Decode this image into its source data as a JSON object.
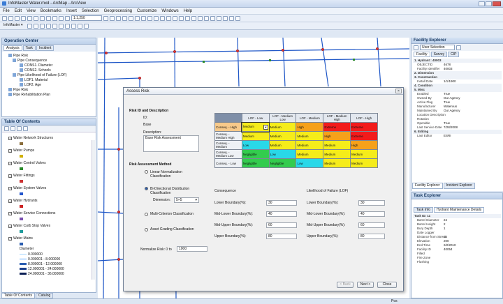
{
  "window": {
    "title": "InfoMaster Water.mxd - ArcMap - ArcView"
  },
  "menu": [
    "File",
    "Edit",
    "View",
    "Bookmarks",
    "Insert",
    "Selection",
    "Geoprocessing",
    "Customize",
    "Windows",
    "Help"
  ],
  "toolbar": {
    "scale": "1:1,250",
    "infomaster_label": "InfoMaster ▾"
  },
  "operation_center": {
    "title": "Operation Center",
    "tabs": [
      "Analysis",
      "Task",
      "Incident"
    ],
    "tree": [
      "Pipe Risk",
      "Pipe Consequence",
      "CONS1. Diameter",
      "CONS2. Schools",
      "Pipe Likelihood of Failure (LOF)",
      "LOF1. Material",
      "LOF2. Age",
      "Pipe Risk",
      "Pipe Rehabilitation Plan"
    ]
  },
  "toc": {
    "title": "Table Of Contents",
    "layers": [
      {
        "name": "Water Network Structures",
        "color": "#8a6d3b"
      },
      {
        "name": "Water Pumps",
        "color": "#d0b000"
      },
      {
        "name": "Water Control Valves",
        "color": "#2a8a2a"
      },
      {
        "name": "Water Fittings",
        "color": "#cc3333"
      },
      {
        "name": "Water System Valves",
        "color": "#2255cc"
      },
      {
        "name": "Water Hydrants",
        "color": "#cc2222"
      },
      {
        "name": "Water Service Connections",
        "color": "#7a4fb0"
      },
      {
        "name": "Water Curb Stop Valves",
        "color": "#1f9b9b"
      },
      {
        "name": "Water Mains",
        "color": "#2a5db0"
      }
    ],
    "legend_title": "Diameter",
    "legend": [
      "0.000000",
      "0.000001 - 8.000000",
      "8.000001 - 12.000000",
      "12.000001 - 24.000000",
      "24.000001 - 36.000000"
    ],
    "bottom_tabs": [
      "Table Of Contents",
      "Catalog"
    ]
  },
  "dialog": {
    "title": "Assess Risk",
    "risk_id_label": "Risk ID and Description",
    "id_label": "ID:",
    "id_value": "Base",
    "desc_label": "Description:",
    "desc_value": "Base Risk Assessment",
    "method_label": "Risk Assessment Method",
    "methods": [
      "Linear Normalization Classification",
      "Bi-Directional Distribution Classification",
      "Multi-Criterion Classification",
      "Asset Grading Classification"
    ],
    "dimension_label": "Dimension:",
    "dimension_value": "5×5",
    "normalize_label": "Normalize Risk: 0 to",
    "normalize_value": "1000",
    "matrix": {
      "cols": [
        "LOF - Low",
        "LOF - Medium Low",
        "LOF - Medium",
        "LOF - Medium High",
        "LOF - High"
      ],
      "rows": [
        {
          "label": "Conseq. - High",
          "cells": [
            [
              "Medium",
              "y"
            ],
            [
              "Medium",
              "y"
            ],
            [
              "High",
              "o"
            ],
            [
              "Extreme",
              "r"
            ],
            [
              "Extreme",
              "r"
            ]
          ]
        },
        {
          "label": "Conseq. - Medium High",
          "cells": [
            [
              "Medium",
              "y"
            ],
            [
              "Medium",
              "y"
            ],
            [
              "Medium",
              "y"
            ],
            [
              "High",
              "o"
            ],
            [
              "Extreme",
              "r"
            ]
          ]
        },
        {
          "label": "Conseq. - Medium",
          "cells": [
            [
              "Low",
              "c"
            ],
            [
              "Medium",
              "y"
            ],
            [
              "Medium",
              "y"
            ],
            [
              "Medium",
              "y"
            ],
            [
              "High",
              "o"
            ]
          ]
        },
        {
          "label": "Conseq. - Medium Low",
          "cells": [
            [
              "Negligible",
              "g"
            ],
            [
              "Low",
              "c"
            ],
            [
              "Medium",
              "y"
            ],
            [
              "Medium",
              "y"
            ],
            [
              "Medium",
              "y"
            ]
          ]
        },
        {
          "label": "Conseq. - Low",
          "cells": [
            [
              "Negligible",
              "g"
            ],
            [
              "Negligible",
              "g"
            ],
            [
              "Low",
              "c"
            ],
            [
              "Medium",
              "y"
            ],
            [
              "Medium",
              "y"
            ]
          ]
        }
      ]
    },
    "consequence_label": "Consequence",
    "lof_label": "Likelihood of Failure (LOF)",
    "bounds": [
      {
        "label": "Lower Boundary(%):",
        "cons": "30",
        "lof": "30"
      },
      {
        "label": "Mid-Lower Boundary(%):",
        "cons": "40",
        "lof": "40"
      },
      {
        "label": "Mid-Upper Boundary(%):",
        "cons": "60",
        "lof": "60"
      },
      {
        "label": "Upper Boundary(%):",
        "cons": "80",
        "lof": "80"
      }
    ],
    "buttons": {
      "back": "< Back",
      "next": "Next >",
      "close": "Close"
    }
  },
  "facility_explorer": {
    "title": "Facility Explorer",
    "selector": "User Selection",
    "tabs": [
      "Facility",
      "Survey",
      "CIP"
    ],
    "rows": [
      {
        "k": "1. Hydrant : 40003",
        "v": "",
        "head": true
      },
      {
        "k": "OBJECTID",
        "v": "4678"
      },
      {
        "k": "Facility Identifier",
        "v": "40003"
      },
      {
        "k": "2. Dimension",
        "v": "",
        "head": true
      },
      {
        "k": "3. Construction",
        "v": "",
        "head": true
      },
      {
        "k": "Install Date",
        "v": "1/1/1900"
      },
      {
        "k": "4. Condition",
        "v": "",
        "head": true
      },
      {
        "k": "5. Misc",
        "v": "",
        "head": true
      },
      {
        "k": "Enabled",
        "v": "True"
      },
      {
        "k": "Owned By",
        "v": "Our Agency"
      },
      {
        "k": "Active Flag",
        "v": "True"
      },
      {
        "k": "Manufacturer",
        "v": "Waterous"
      },
      {
        "k": "Maintained By",
        "v": "Our Agency"
      },
      {
        "k": "Location Description",
        "v": ""
      },
      {
        "k": "Rotation",
        "v": ""
      },
      {
        "k": "Operable",
        "v": "True"
      },
      {
        "k": "Last Service Date",
        "v": "7/28/2008"
      },
      {
        "k": "6. Editing",
        "v": "",
        "head": true
      },
      {
        "k": "Last Editor",
        "v": "ESRI"
      }
    ],
    "bottom_tabs": [
      "Facility Explorer",
      "Incident Explorer"
    ]
  },
  "task_explorer": {
    "title": "Task Explorer",
    "tabs": [
      "Task Info",
      "Hydrant Maintenance Details"
    ],
    "rows": [
      {
        "k": "Task ID: 11",
        "v": "",
        "head": true
      },
      {
        "k": "Barrel Diameter",
        "v": "24"
      },
      {
        "k": "Barrel Height",
        "v": "2"
      },
      {
        "k": "Bury Depth",
        "v": "1"
      },
      {
        "k": "Date Logger",
        "v": ""
      },
      {
        "k": "Distance from Street",
        "v": "15"
      },
      {
        "k": "Elevation",
        "v": "200"
      },
      {
        "k": "End Time",
        "v": "2/2/2010"
      },
      {
        "k": "Facility ID",
        "v": "40054"
      },
      {
        "k": "Filled",
        "v": ""
      },
      {
        "k": "Fire Zone",
        "v": ""
      },
      {
        "k": "Flushing",
        "v": ""
      }
    ]
  },
  "status": {
    "text": "Pos"
  }
}
